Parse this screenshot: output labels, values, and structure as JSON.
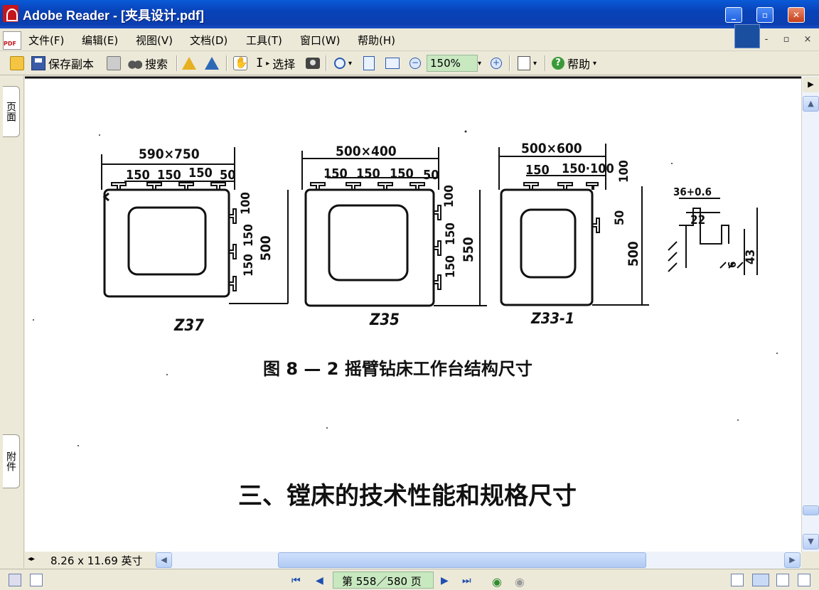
{
  "window": {
    "title": "Adobe Reader - [夹具设计.pdf]",
    "minimize": "_",
    "restore": "▫",
    "close": "✕"
  },
  "menu": {
    "items": [
      "文件(F)",
      "编辑(E)",
      "视图(V)",
      "文档(D)",
      "工具(T)",
      "窗口(W)",
      "帮助(H)"
    ],
    "mdi_minimize": "-",
    "mdi_restore": "▫",
    "mdi_close": "×"
  },
  "toolbar": {
    "save_copy": "保存副本",
    "search": "搜索",
    "select": "选择",
    "zoom": "150%",
    "help": "帮助"
  },
  "side_tabs": {
    "pages": "页面",
    "attachments": "附件"
  },
  "document": {
    "fig_labels": {
      "z37_size": "590×750",
      "z35_size": "500×400",
      "z33_size": "500×600",
      "dim_150": "150",
      "dim_50": "50",
      "dim_100": "100",
      "dim_500": "500",
      "dim_550": "550",
      "dim_150_100": "150·100",
      "detail_36": "36+0.6",
      "detail_22": "22",
      "detail_43": "43",
      "detail_6": "6",
      "z37": "Z37",
      "z35": "Z35",
      "z33": "Z33-1"
    },
    "caption": "图 8 — 2    摇臂钻床工作台结构尺寸",
    "heading": "三、镗床的技术性能和规格尺寸"
  },
  "status": {
    "page_size": "8.26 x 11.69 英寸"
  },
  "nav": {
    "page_display": "第 558／580 页"
  }
}
